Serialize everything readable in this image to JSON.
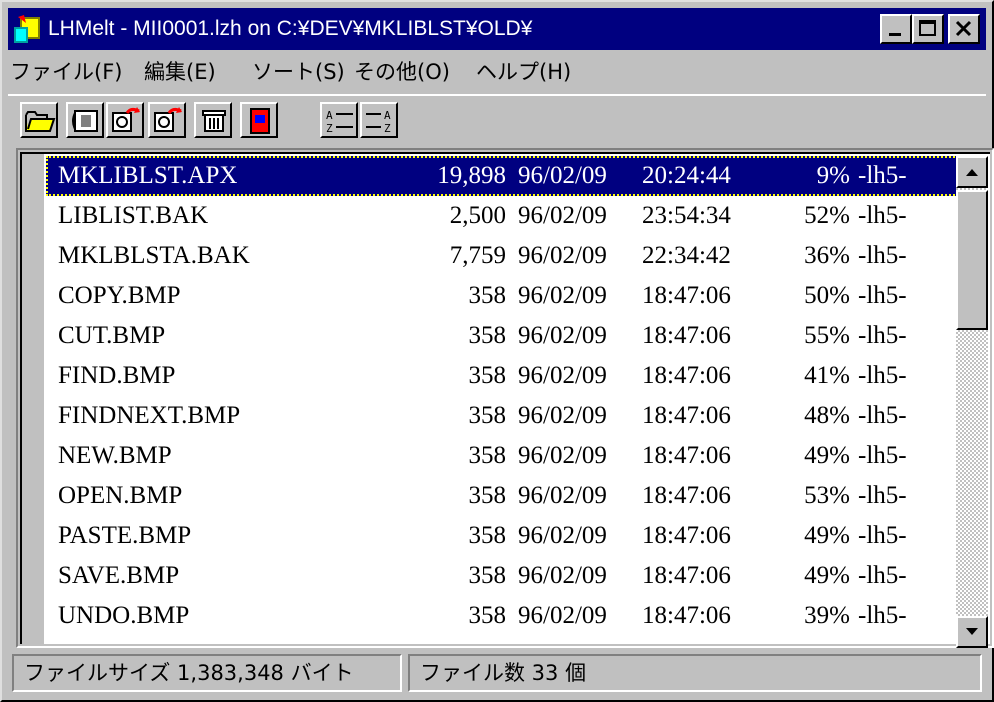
{
  "window": {
    "title": "LHMelt - MII0001.lzh on C:¥DEV¥MKLIBLST¥OLD¥"
  },
  "menu": [
    "ファイル(F)",
    "編集(E)",
    "ソート(S)",
    "その他(O)",
    "ヘルプ(H)"
  ],
  "toolbar": {
    "buttons": [
      "open-folder-icon",
      "extract-book-icon",
      "move-files-icon",
      "copy-files-icon",
      "delete-trash-icon",
      "exit-door-icon",
      "sort-ascending-icon",
      "sort-descending-icon"
    ]
  },
  "files": [
    {
      "name": "MKLIBLST.APX",
      "size": "19,898",
      "date": "96/02/09",
      "time": "20:24:44",
      "ratio": "9%",
      "method": "-lh5-"
    },
    {
      "name": "LIBLIST.BAK",
      "size": "2,500",
      "date": "96/02/09",
      "time": "23:54:34",
      "ratio": "52%",
      "method": "-lh5-"
    },
    {
      "name": "MKLBLSTA.BAK",
      "size": "7,759",
      "date": "96/02/09",
      "time": "22:34:42",
      "ratio": "36%",
      "method": "-lh5-"
    },
    {
      "name": "COPY.BMP",
      "size": "358",
      "date": "96/02/09",
      "time": "18:47:06",
      "ratio": "50%",
      "method": "-lh5-"
    },
    {
      "name": "CUT.BMP",
      "size": "358",
      "date": "96/02/09",
      "time": "18:47:06",
      "ratio": "55%",
      "method": "-lh5-"
    },
    {
      "name": "FIND.BMP",
      "size": "358",
      "date": "96/02/09",
      "time": "18:47:06",
      "ratio": "41%",
      "method": "-lh5-"
    },
    {
      "name": "FINDNEXT.BMP",
      "size": "358",
      "date": "96/02/09",
      "time": "18:47:06",
      "ratio": "48%",
      "method": "-lh5-"
    },
    {
      "name": "NEW.BMP",
      "size": "358",
      "date": "96/02/09",
      "time": "18:47:06",
      "ratio": "49%",
      "method": "-lh5-"
    },
    {
      "name": "OPEN.BMP",
      "size": "358",
      "date": "96/02/09",
      "time": "18:47:06",
      "ratio": "53%",
      "method": "-lh5-"
    },
    {
      "name": "PASTE.BMP",
      "size": "358",
      "date": "96/02/09",
      "time": "18:47:06",
      "ratio": "49%",
      "method": "-lh5-"
    },
    {
      "name": "SAVE.BMP",
      "size": "358",
      "date": "96/02/09",
      "time": "18:47:06",
      "ratio": "49%",
      "method": "-lh5-"
    },
    {
      "name": "UNDO.BMP",
      "size": "358",
      "date": "96/02/09",
      "time": "18:47:06",
      "ratio": "39%",
      "method": "-lh5-"
    }
  ],
  "status": {
    "file_size": "ファイルサイズ  1,383,348 バイト",
    "file_count": "ファイル数  33 個"
  },
  "colors": {
    "title_bar": "#000080",
    "selection": "#000080",
    "face": "#c0c0c0"
  }
}
